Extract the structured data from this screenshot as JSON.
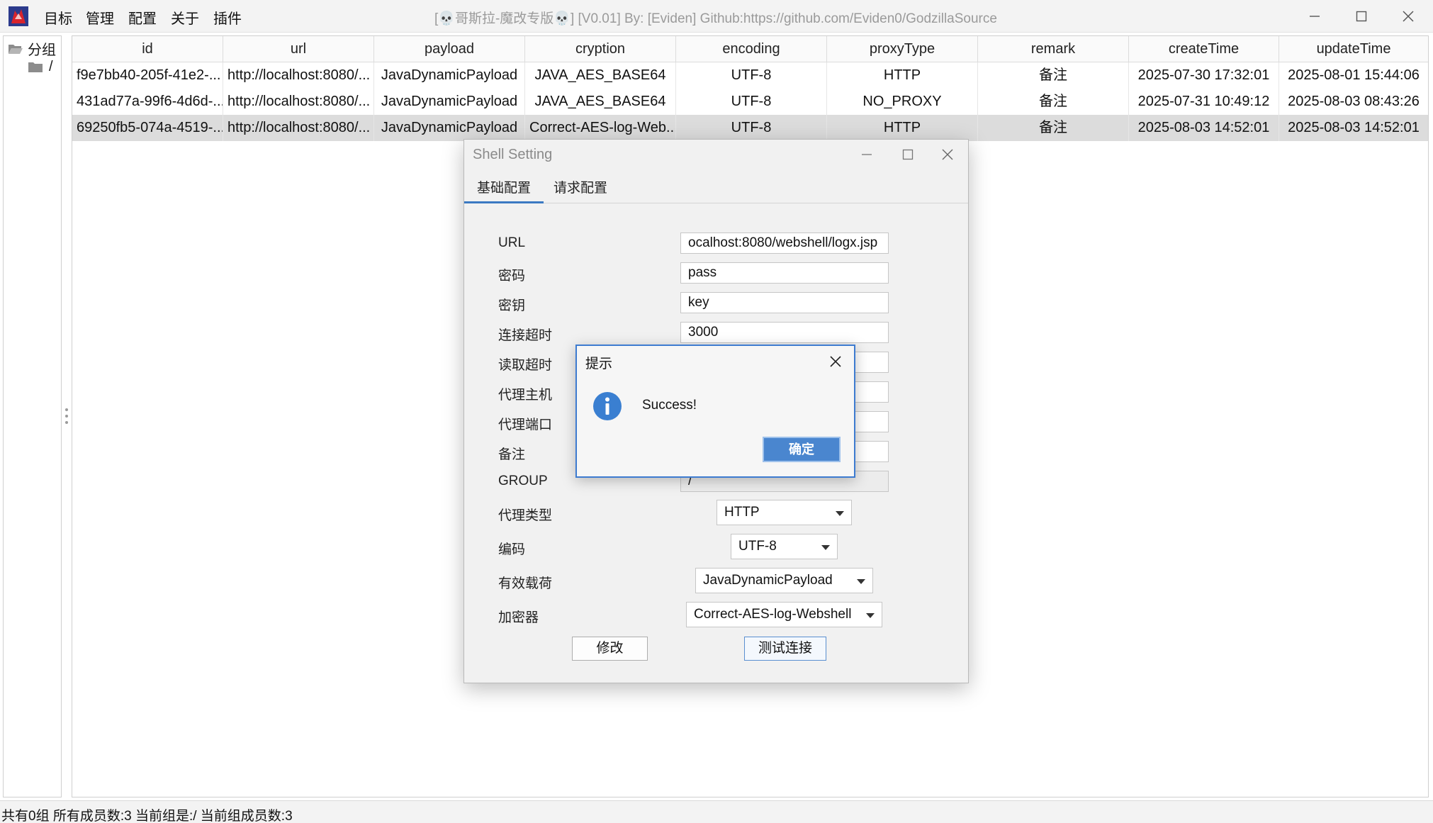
{
  "window": {
    "title": "[💀哥斯拉-魔改专版💀] [V0.01] By: [Eviden] Github:https://github.com/Eviden0/GodzillaSource",
    "icon": "godzilla-app-icon"
  },
  "menu": [
    "目标",
    "管理",
    "配置",
    "关于",
    "插件"
  ],
  "sidebar": {
    "root_label": "分组",
    "child_label": "/"
  },
  "table": {
    "columns": [
      "id",
      "url",
      "payload",
      "cryption",
      "encoding",
      "proxyType",
      "remark",
      "createTime",
      "updateTime"
    ],
    "rows": [
      [
        "f9e7bb40-205f-41e2-...",
        "http://localhost:8080/...",
        "JavaDynamicPayload",
        "JAVA_AES_BASE64",
        "UTF-8",
        "HTTP",
        "备注",
        "2025-07-30 17:32:01",
        "2025-08-01 15:44:06"
      ],
      [
        "431ad77a-99f6-4d6d-...",
        "http://localhost:8080/...",
        "JavaDynamicPayload",
        "JAVA_AES_BASE64",
        "UTF-8",
        "NO_PROXY",
        "备注",
        "2025-07-31 10:49:12",
        "2025-08-03 08:43:26"
      ],
      [
        "69250fb5-074a-4519-...",
        "http://localhost:8080/...",
        "JavaDynamicPayload",
        "Correct-AES-log-Web...",
        "UTF-8",
        "HTTP",
        "备注",
        "2025-08-03 14:52:01",
        "2025-08-03 14:52:01"
      ]
    ],
    "selected_row": 3
  },
  "status": "共有0组 所有成员数:3 当前组是:/ 当前组成员数:3",
  "shell_setting": {
    "title": "Shell Setting",
    "tabs": [
      "基础配置",
      "请求配置"
    ],
    "active_tab": "基础配置",
    "labels": {
      "url": "URL",
      "password": "密码",
      "key": "密钥",
      "connect_timeout": "连接超时",
      "read_timeout": "读取超时",
      "proxy_host": "代理主机",
      "proxy_port": "代理端口",
      "remark": "备注",
      "group": "GROUP",
      "proxy_type": "代理类型",
      "encoding": "编码",
      "payload": "有效载荷",
      "cryption": "加密器"
    },
    "values": {
      "url": "ocalhost:8080/webshell/logx.jsp",
      "password": "pass",
      "key": "key",
      "connect_timeout": "3000",
      "group": "/"
    },
    "selects": {
      "proxy_type": "HTTP",
      "encoding": "UTF-8",
      "payload": "JavaDynamicPayload",
      "cryption": "Correct-AES-log-Webshell"
    },
    "buttons": {
      "modify": "修改",
      "test": "测试连接"
    }
  },
  "message_box": {
    "title": "提示",
    "text": "Success!",
    "ok": "确定",
    "icon": "info-icon"
  },
  "colors": {
    "accent": "#3b79c2",
    "ok_button": "#4a86cf",
    "info_icon": "#3a7fd1",
    "selected_row": "#dcdcdc"
  }
}
